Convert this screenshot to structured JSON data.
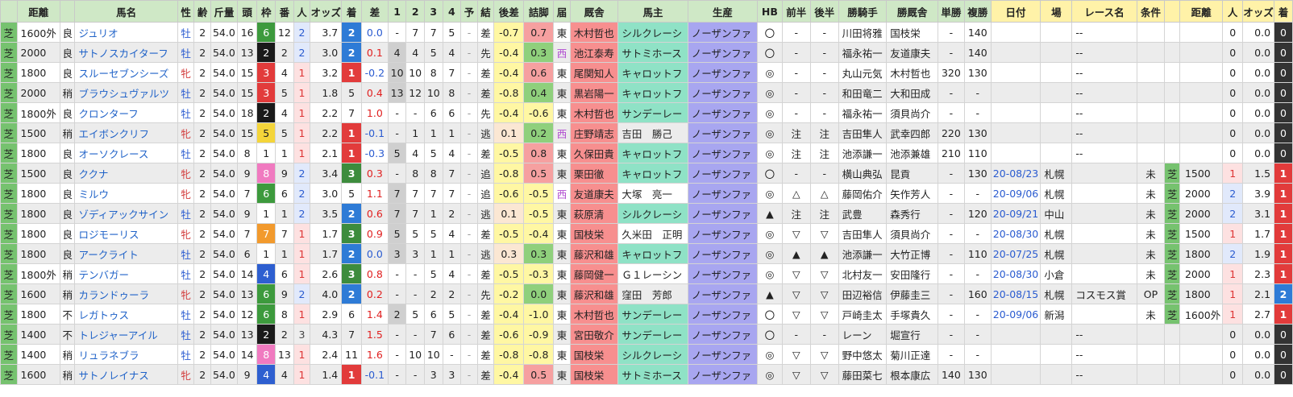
{
  "headers": [
    "",
    "距離",
    "",
    "馬名",
    "性",
    "齢",
    "斤量",
    "頭",
    "枠",
    "番",
    "人",
    "オッズ",
    "着",
    "差",
    "1",
    "2",
    "3",
    "4",
    "予",
    "結",
    "後差",
    "詰脚",
    "届",
    "厩舎",
    "馬主",
    "生産",
    "HB",
    "前半",
    "後半",
    "勝騎手",
    "勝厩舎",
    "単勝",
    "複勝",
    "日付",
    "場",
    "レース名",
    "条件",
    "",
    "距離",
    "人",
    "オッズ",
    "着"
  ],
  "rows": [
    {
      "surf": "芝",
      "dist": "1600外",
      "cond": "良",
      "name": "ジュリオ",
      "sex": "牡",
      "age": "2",
      "wt": "54.0",
      "heads": "16",
      "waku": "6",
      "ban": "12",
      "pop": "2",
      "odds": "3.7",
      "fin": "2",
      "diff": "0.0",
      "p1": "-",
      "p2": "7",
      "p3": "7",
      "p4": "5",
      "yo": "-",
      "ke": "差",
      "kosa": "-0.7",
      "tsume": "0.7",
      "todoke": "東",
      "trainer": "木村哲也",
      "owner": "シルクレーシ",
      "prod": "ノーザンファ",
      "hb": "〇",
      "zen": "-",
      "kou": "-",
      "wj": "川田将雅",
      "wt2": "国枝栄",
      "tan": "-",
      "fuku": "140",
      "date": "",
      "place": "",
      "race": "--",
      "cls": "",
      "surf2": "",
      "dist2": "",
      "pop2": "0",
      "odds2": "0.0",
      "fin2": "0"
    },
    {
      "surf": "芝",
      "dist": "2000",
      "cond": "良",
      "name": "サトノスカイターフ",
      "sex": "牡",
      "age": "2",
      "wt": "54.0",
      "heads": "13",
      "waku": "2",
      "ban": "2",
      "pop": "2",
      "odds": "3.0",
      "fin": "2",
      "diff": "0.1",
      "p1": "4",
      "p2": "4",
      "p3": "5",
      "p4": "4",
      "yo": "-",
      "ke": "先",
      "kosa": "-0.4",
      "tsume": "0.3",
      "todoke": "西",
      "trainer": "池江泰寿",
      "owner": "サトミホース",
      "prod": "ノーザンファ",
      "hb": "〇",
      "zen": "-",
      "kou": "-",
      "wj": "福永祐一",
      "wt2": "友道康夫",
      "tan": "-",
      "fuku": "140",
      "date": "",
      "place": "",
      "race": "--",
      "cls": "",
      "surf2": "",
      "dist2": "",
      "pop2": "0",
      "odds2": "0.0",
      "fin2": "0"
    },
    {
      "surf": "芝",
      "dist": "1800",
      "cond": "良",
      "name": "スルーセブンシーズ",
      "sex": "牝",
      "age": "2",
      "wt": "54.0",
      "heads": "15",
      "waku": "3",
      "ban": "4",
      "pop": "1",
      "odds": "3.2",
      "fin": "1",
      "diff": "-0.2",
      "p1": "10",
      "p2": "10",
      "p3": "8",
      "p4": "7",
      "yo": "-",
      "ke": "差",
      "kosa": "-0.4",
      "tsume": "0.6",
      "todoke": "東",
      "trainer": "尾関知人",
      "owner": "キャロットフ",
      "prod": "ノーザンファ",
      "hb": "◎",
      "zen": "-",
      "kou": "-",
      "wj": "丸山元気",
      "wt2": "木村哲也",
      "tan": "320",
      "fuku": "130",
      "date": "",
      "place": "",
      "race": "--",
      "cls": "",
      "surf2": "",
      "dist2": "",
      "pop2": "0",
      "odds2": "0.0",
      "fin2": "0"
    },
    {
      "surf": "芝",
      "dist": "2000",
      "cond": "稍",
      "name": "ブラウシュヴァルツ",
      "sex": "牡",
      "age": "2",
      "wt": "54.0",
      "heads": "15",
      "waku": "3",
      "ban": "5",
      "pop": "1",
      "odds": "1.8",
      "fin": "5",
      "diff": "0.4",
      "p1": "13",
      "p2": "12",
      "p3": "10",
      "p4": "8",
      "yo": "-",
      "ke": "差",
      "kosa": "-0.8",
      "tsume": "0.4",
      "todoke": "東",
      "trainer": "黒岩陽一",
      "owner": "キャロットフ",
      "prod": "ノーザンファ",
      "hb": "◎",
      "zen": "-",
      "kou": "-",
      "wj": "和田竜二",
      "wt2": "大和田成",
      "tan": "-",
      "fuku": "-",
      "date": "",
      "place": "",
      "race": "--",
      "cls": "",
      "surf2": "",
      "dist2": "",
      "pop2": "0",
      "odds2": "0.0",
      "fin2": "0"
    },
    {
      "surf": "芝",
      "dist": "1800外",
      "cond": "良",
      "name": "クロンターフ",
      "sex": "牡",
      "age": "2",
      "wt": "54.0",
      "heads": "18",
      "waku": "2",
      "ban": "4",
      "pop": "1",
      "odds": "2.2",
      "fin": "7",
      "diff": "1.0",
      "p1": "-",
      "p2": "-",
      "p3": "6",
      "p4": "6",
      "yo": "-",
      "ke": "先",
      "kosa": "-0.4",
      "tsume": "-0.6",
      "todoke": "東",
      "trainer": "木村哲也",
      "owner": "サンデーレー",
      "prod": "ノーザンファ",
      "hb": "◎",
      "zen": "-",
      "kou": "-",
      "wj": "福永祐一",
      "wt2": "須貝尚介",
      "tan": "-",
      "fuku": "-",
      "date": "",
      "place": "",
      "race": "--",
      "cls": "",
      "surf2": "",
      "dist2": "",
      "pop2": "0",
      "odds2": "0.0",
      "fin2": "0"
    },
    {
      "surf": "芝",
      "dist": "1500",
      "cond": "稍",
      "name": "エイボンクリフ",
      "sex": "牝",
      "age": "2",
      "wt": "54.0",
      "heads": "15",
      "waku": "5",
      "ban": "5",
      "pop": "1",
      "odds": "2.2",
      "fin": "1",
      "diff": "-0.1",
      "p1": "-",
      "p2": "1",
      "p3": "1",
      "p4": "1",
      "yo": "-",
      "ke": "逃",
      "kosa": "0.1",
      "tsume": "0.2",
      "todoke": "西",
      "trainer": "庄野靖志",
      "owner": "吉田　勝己",
      "prod": "ノーザンファ",
      "hb": "◎",
      "zen": "注",
      "kou": "注",
      "wj": "吉田隼人",
      "wt2": "武幸四郎",
      "tan": "220",
      "fuku": "130",
      "date": "",
      "place": "",
      "race": "--",
      "cls": "",
      "surf2": "",
      "dist2": "",
      "pop2": "0",
      "odds2": "0.0",
      "fin2": "0"
    },
    {
      "surf": "芝",
      "dist": "1800",
      "cond": "良",
      "name": "オーソクレース",
      "sex": "牡",
      "age": "2",
      "wt": "54.0",
      "heads": "8",
      "waku": "1",
      "ban": "1",
      "pop": "1",
      "odds": "2.1",
      "fin": "1",
      "diff": "-0.3",
      "p1": "5",
      "p2": "4",
      "p3": "5",
      "p4": "4",
      "yo": "-",
      "ke": "差",
      "kosa": "-0.5",
      "tsume": "0.8",
      "todoke": "東",
      "trainer": "久保田貴",
      "owner": "キャロットフ",
      "prod": "ノーザンファ",
      "hb": "◎",
      "zen": "注",
      "kou": "注",
      "wj": "池添謙一",
      "wt2": "池添兼雄",
      "tan": "210",
      "fuku": "110",
      "date": "",
      "place": "",
      "race": "--",
      "cls": "",
      "surf2": "",
      "dist2": "",
      "pop2": "0",
      "odds2": "0.0",
      "fin2": "0"
    },
    {
      "surf": "芝",
      "dist": "1500",
      "cond": "良",
      "name": "ククナ",
      "sex": "牝",
      "age": "2",
      "wt": "54.0",
      "heads": "9",
      "waku": "8",
      "ban": "9",
      "pop": "2",
      "odds": "3.4",
      "fin": "3",
      "diff": "0.3",
      "p1": "-",
      "p2": "8",
      "p3": "8",
      "p4": "7",
      "yo": "-",
      "ke": "追",
      "kosa": "-0.8",
      "tsume": "0.5",
      "todoke": "東",
      "trainer": "栗田徹",
      "owner": "キャロットフ",
      "prod": "ノーザンファ",
      "hb": "〇",
      "zen": "-",
      "kou": "-",
      "wj": "横山典弘",
      "wt2": "昆貢",
      "tan": "-",
      "fuku": "130",
      "date": "20-08/23",
      "place": "札幌",
      "race": "",
      "cls": "未",
      "surf2": "芝",
      "dist2": "1500",
      "pop2": "1",
      "odds2": "1.5",
      "fin2": "1"
    },
    {
      "surf": "芝",
      "dist": "1800",
      "cond": "良",
      "name": "ミルウ",
      "sex": "牝",
      "age": "2",
      "wt": "54.0",
      "heads": "7",
      "waku": "6",
      "ban": "6",
      "pop": "2",
      "odds": "3.0",
      "fin": "5",
      "diff": "1.1",
      "p1": "7",
      "p2": "7",
      "p3": "7",
      "p4": "7",
      "yo": "-",
      "ke": "追",
      "kosa": "-0.6",
      "tsume": "-0.5",
      "todoke": "西",
      "trainer": "友道康夫",
      "owner": "大塚　亮一",
      "prod": "ノーザンファ",
      "hb": "◎",
      "zen": "△",
      "kou": "△",
      "wj": "藤岡佑介",
      "wt2": "矢作芳人",
      "tan": "-",
      "fuku": "-",
      "date": "20-09/06",
      "place": "札幌",
      "race": "",
      "cls": "未",
      "surf2": "芝",
      "dist2": "2000",
      "pop2": "2",
      "odds2": "3.9",
      "fin2": "1"
    },
    {
      "surf": "芝",
      "dist": "1800",
      "cond": "良",
      "name": "ゾディアックサイン",
      "sex": "牡",
      "age": "2",
      "wt": "54.0",
      "heads": "9",
      "waku": "1",
      "ban": "1",
      "pop": "2",
      "odds": "3.5",
      "fin": "2",
      "diff": "0.6",
      "p1": "7",
      "p2": "7",
      "p3": "1",
      "p4": "2",
      "yo": "-",
      "ke": "逃",
      "kosa": "0.1",
      "tsume": "-0.5",
      "todoke": "東",
      "trainer": "萩原清",
      "owner": "シルクレーシ",
      "prod": "ノーザンファ",
      "hb": "▲",
      "zen": "注",
      "kou": "注",
      "wj": "武豊",
      "wt2": "森秀行",
      "tan": "-",
      "fuku": "120",
      "date": "20-09/21",
      "place": "中山",
      "race": "",
      "cls": "未",
      "surf2": "芝",
      "dist2": "2000",
      "pop2": "2",
      "odds2": "3.1",
      "fin2": "1"
    },
    {
      "surf": "芝",
      "dist": "1800",
      "cond": "良",
      "name": "ロジモーリス",
      "sex": "牝",
      "age": "2",
      "wt": "54.0",
      "heads": "7",
      "waku": "7",
      "ban": "7",
      "pop": "1",
      "odds": "1.7",
      "fin": "3",
      "diff": "0.9",
      "p1": "5",
      "p2": "5",
      "p3": "5",
      "p4": "4",
      "yo": "-",
      "ke": "差",
      "kosa": "-0.5",
      "tsume": "-0.4",
      "todoke": "東",
      "trainer": "国枝栄",
      "owner": "久米田　正明",
      "prod": "ノーザンファ",
      "hb": "◎",
      "zen": "▽",
      "kou": "▽",
      "wj": "吉田隼人",
      "wt2": "須貝尚介",
      "tan": "-",
      "fuku": "-",
      "date": "20-08/30",
      "place": "札幌",
      "race": "",
      "cls": "未",
      "surf2": "芝",
      "dist2": "1500",
      "pop2": "1",
      "odds2": "1.7",
      "fin2": "1"
    },
    {
      "surf": "芝",
      "dist": "1800",
      "cond": "良",
      "name": "アークライト",
      "sex": "牡",
      "age": "2",
      "wt": "54.0",
      "heads": "6",
      "waku": "1",
      "ban": "1",
      "pop": "1",
      "odds": "1.7",
      "fin": "2",
      "diff": "0.0",
      "p1": "3",
      "p2": "3",
      "p3": "1",
      "p4": "1",
      "yo": "-",
      "ke": "逃",
      "kosa": "0.3",
      "tsume": "0.3",
      "todoke": "東",
      "trainer": "藤沢和雄",
      "owner": "キャロットフ",
      "prod": "ノーザンファ",
      "hb": "◎",
      "zen": "▲",
      "kou": "▲",
      "wj": "池添謙一",
      "wt2": "大竹正博",
      "tan": "-",
      "fuku": "110",
      "date": "20-07/25",
      "place": "札幌",
      "race": "",
      "cls": "未",
      "surf2": "芝",
      "dist2": "1800",
      "pop2": "2",
      "odds2": "1.9",
      "fin2": "1"
    },
    {
      "surf": "芝",
      "dist": "1800外",
      "cond": "稍",
      "name": "テンバガー",
      "sex": "牡",
      "age": "2",
      "wt": "54.0",
      "heads": "14",
      "waku": "4",
      "ban": "6",
      "pop": "1",
      "odds": "2.6",
      "fin": "3",
      "diff": "0.8",
      "p1": "-",
      "p2": "-",
      "p3": "5",
      "p4": "4",
      "yo": "-",
      "ke": "差",
      "kosa": "-0.5",
      "tsume": "-0.3",
      "todoke": "東",
      "trainer": "藤岡健一",
      "owner": "Ｇ１レーシン",
      "prod": "ノーザンファ",
      "hb": "◎",
      "zen": "▽",
      "kou": "▽",
      "wj": "北村友一",
      "wt2": "安田隆行",
      "tan": "-",
      "fuku": "-",
      "date": "20-08/30",
      "place": "小倉",
      "race": "",
      "cls": "未",
      "surf2": "芝",
      "dist2": "2000",
      "pop2": "1",
      "odds2": "2.3",
      "fin2": "1"
    },
    {
      "surf": "芝",
      "dist": "1600",
      "cond": "稍",
      "name": "カランドゥーラ",
      "sex": "牝",
      "age": "2",
      "wt": "54.0",
      "heads": "13",
      "waku": "6",
      "ban": "9",
      "pop": "2",
      "odds": "4.0",
      "fin": "2",
      "diff": "0.2",
      "p1": "-",
      "p2": "-",
      "p3": "2",
      "p4": "2",
      "yo": "-",
      "ke": "先",
      "kosa": "-0.2",
      "tsume": "0.0",
      "todoke": "東",
      "trainer": "藤沢和雄",
      "owner": "窪田　芳郎",
      "prod": "ノーザンファ",
      "hb": "▲",
      "zen": "▽",
      "kou": "▽",
      "wj": "田辺裕信",
      "wt2": "伊藤圭三",
      "tan": "-",
      "fuku": "160",
      "date": "20-08/15",
      "place": "札幌",
      "race": "コスモス賞",
      "cls": "OP",
      "surf2": "芝",
      "dist2": "1800",
      "pop2": "1",
      "odds2": "2.1",
      "fin2": "2"
    },
    {
      "surf": "芝",
      "dist": "1800",
      "cond": "不",
      "name": "レガトゥス",
      "sex": "牡",
      "age": "2",
      "wt": "54.0",
      "heads": "12",
      "waku": "6",
      "ban": "8",
      "pop": "1",
      "odds": "2.9",
      "fin": "6",
      "diff": "1.4",
      "p1": "2",
      "p2": "5",
      "p3": "6",
      "p4": "5",
      "yo": "-",
      "ke": "差",
      "kosa": "-0.4",
      "tsume": "-1.0",
      "todoke": "東",
      "trainer": "木村哲也",
      "owner": "サンデーレー",
      "prod": "ノーザンファ",
      "hb": "〇",
      "zen": "▽",
      "kou": "▽",
      "wj": "戸崎圭太",
      "wt2": "手塚貴久",
      "tan": "-",
      "fuku": "-",
      "date": "20-09/06",
      "place": "新潟",
      "race": "",
      "cls": "未",
      "surf2": "芝",
      "dist2": "1600外",
      "pop2": "1",
      "odds2": "2.7",
      "fin2": "1"
    },
    {
      "surf": "芝",
      "dist": "1400",
      "cond": "不",
      "name": "トレジャーアイル",
      "sex": "牡",
      "age": "2",
      "wt": "54.0",
      "heads": "13",
      "waku": "2",
      "ban": "2",
      "pop": "3",
      "odds": "4.3",
      "fin": "7",
      "diff": "1.5",
      "p1": "-",
      "p2": "-",
      "p3": "7",
      "p4": "6",
      "yo": "-",
      "ke": "差",
      "kosa": "-0.6",
      "tsume": "-0.9",
      "todoke": "東",
      "trainer": "宮田敬介",
      "owner": "サンデーレー",
      "prod": "ノーザンファ",
      "hb": "〇",
      "zen": "-",
      "kou": "-",
      "wj": "レーン",
      "wt2": "堀宣行",
      "tan": "-",
      "fuku": "-",
      "date": "",
      "place": "",
      "race": "--",
      "cls": "",
      "surf2": "",
      "dist2": "",
      "pop2": "0",
      "odds2": "0.0",
      "fin2": "0"
    },
    {
      "surf": "芝",
      "dist": "1400",
      "cond": "稍",
      "name": "リュラネブラ",
      "sex": "牡",
      "age": "2",
      "wt": "54.0",
      "heads": "14",
      "waku": "8",
      "ban": "13",
      "pop": "1",
      "odds": "2.4",
      "fin": "11",
      "diff": "1.6",
      "p1": "-",
      "p2": "10",
      "p3": "10",
      "p4": "-",
      "yo": "-",
      "ke": "差",
      "kosa": "-0.8",
      "tsume": "-0.8",
      "todoke": "東",
      "trainer": "国枝栄",
      "owner": "シルクレーシ",
      "prod": "ノーザンファ",
      "hb": "◎",
      "zen": "▽",
      "kou": "▽",
      "wj": "野中悠太",
      "wt2": "菊川正達",
      "tan": "-",
      "fuku": "-",
      "date": "",
      "place": "",
      "race": "--",
      "cls": "",
      "surf2": "",
      "dist2": "",
      "pop2": "0",
      "odds2": "0.0",
      "fin2": "0"
    },
    {
      "surf": "芝",
      "dist": "1600",
      "cond": "稍",
      "name": "サトノレイナス",
      "sex": "牝",
      "age": "2",
      "wt": "54.0",
      "heads": "9",
      "waku": "4",
      "ban": "4",
      "pop": "1",
      "odds": "1.4",
      "fin": "1",
      "diff": "-0.1",
      "p1": "-",
      "p2": "-",
      "p3": "3",
      "p4": "3",
      "yo": "-",
      "ke": "差",
      "kosa": "-0.4",
      "tsume": "0.5",
      "todoke": "東",
      "trainer": "国枝栄",
      "owner": "サトミホース",
      "prod": "ノーザンファ",
      "hb": "◎",
      "zen": "▽",
      "kou": "▽",
      "wj": "藤田菜七",
      "wt2": "根本康広",
      "tan": "140",
      "fuku": "130",
      "date": "",
      "place": "",
      "race": "--",
      "cls": "",
      "surf2": "",
      "dist2": "",
      "pop2": "0",
      "odds2": "0.0",
      "fin2": "0"
    }
  ]
}
